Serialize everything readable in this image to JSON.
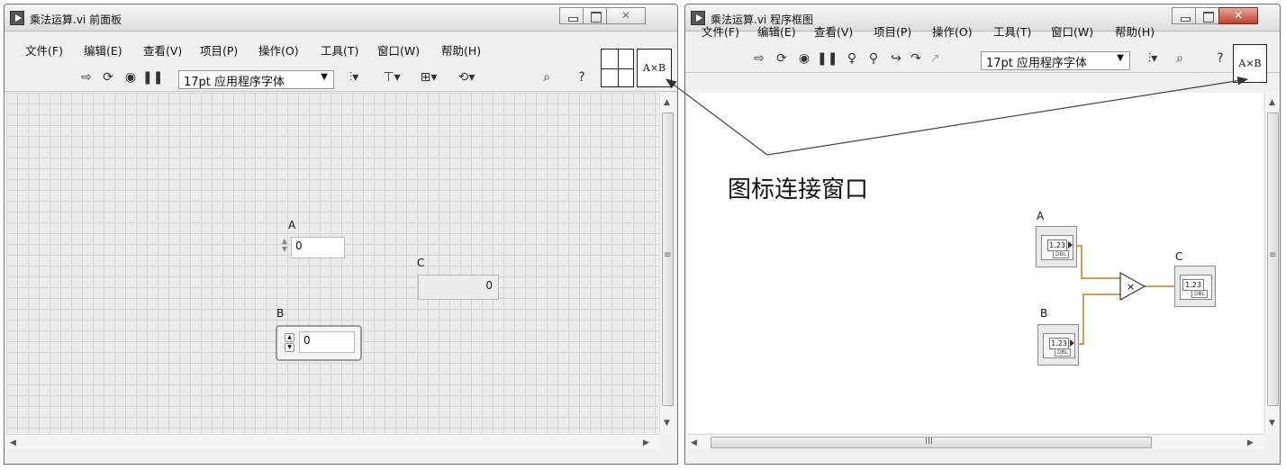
{
  "front_panel": {
    "title": "乘法运算.vi 前面板",
    "menu": [
      "文件(F)",
      "编辑(E)",
      "查看(V)",
      "项目(P)",
      "操作(O)",
      "工具(T)",
      "窗口(W)",
      "帮助(H)"
    ],
    "font": "17pt 应用程序字体",
    "icon_text": "A×B",
    "controls": {
      "a_label": "A",
      "a_value": "0",
      "b_label": "B",
      "b_value": "0",
      "c_label": "C",
      "c_value": "0"
    }
  },
  "block_diagram": {
    "title": "乘法运算.vi 程序框图",
    "menu": [
      "文件(F)",
      "编辑(E)",
      "查看(V)",
      "项目(P)",
      "操作(O)",
      "工具(T)",
      "窗口(W)",
      "帮助(H)"
    ],
    "font": "17pt 应用程序字体",
    "icon_text": "A×B",
    "terminals": {
      "a_label": "A",
      "b_label": "B",
      "c_label": "C",
      "value_text": "1.23",
      "type_text": "DBL",
      "multiply_symbol": "×"
    },
    "scroll_grip": "III"
  },
  "annotation": "图标连接窗口",
  "colors": {
    "grid": "#d3d3d3",
    "panel": "#ececec",
    "close_red": "#c2402b"
  },
  "icons": [
    "run-arrow-icon",
    "run-continuously-icon",
    "abort-icon",
    "pause-icon",
    "highlight-bulb-icon",
    "retain-wire-icon",
    "step-into-icon",
    "step-over-icon",
    "step-out-icon",
    "align-icon",
    "distribute-icon",
    "resize-icon",
    "reorder-icon",
    "search-icon",
    "help-icon"
  ]
}
